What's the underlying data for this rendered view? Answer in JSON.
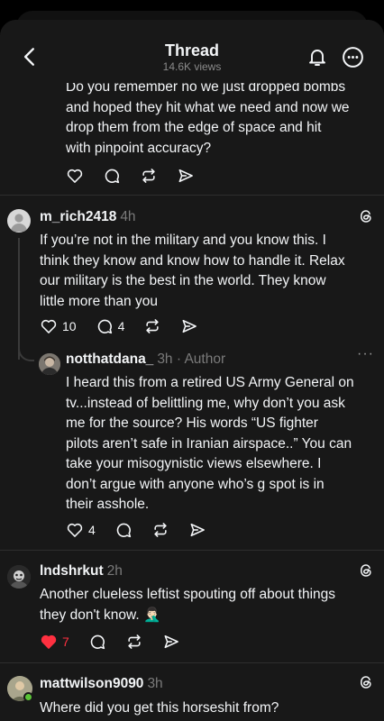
{
  "header": {
    "title": "Thread",
    "views": "14.6K views"
  },
  "posts": [
    {
      "text": [
        "Do you remember no we just dropped bombs",
        "and hoped they hit what we need and now we",
        "drop them from the edge of space and hit",
        "with pinpoint accuracy?"
      ]
    },
    {
      "username": "m_rich2418",
      "time": "4h",
      "text": [
        "If you’re not in the military and you know this. I",
        "think they know and know how to handle it. Relax",
        "our military is the best in the world. They know",
        "little more than you"
      ],
      "likes": "10",
      "replies": "4"
    },
    {
      "username": "notthatdana_",
      "time": "3h · Author",
      "text": [
        "I heard this from a retired US Army General on",
        "tv...instead of belittling me, why don’t you ask",
        "me for the source? His words “US fighter",
        "pilots aren’t safe in Iranian airspace..” You can",
        "take your misogynistic views elsewhere. I",
        "don’t argue with anyone who’s g spot is in",
        "their asshole."
      ],
      "likes": "4",
      "more": "···"
    },
    {
      "username": "lndshrkut",
      "time": "2h",
      "text": [
        "Another clueless leftist spouting off about things",
        "they don't know. 🤦🏻‍♂️"
      ],
      "likes": "7"
    },
    {
      "username": "mattwilson9090",
      "time": "3h",
      "text": [
        "Where did you get this horseshit from?"
      ]
    }
  ],
  "colors": {
    "background": "#181818",
    "like_active": "#ff3040",
    "online_dot": "#5ac437",
    "muted": "#7a7a7a"
  },
  "icons": [
    "back-arrow-icon",
    "bell-icon",
    "more-icon",
    "heart-icon",
    "comment-icon",
    "repost-icon",
    "share-icon",
    "threads-logo-icon"
  ]
}
